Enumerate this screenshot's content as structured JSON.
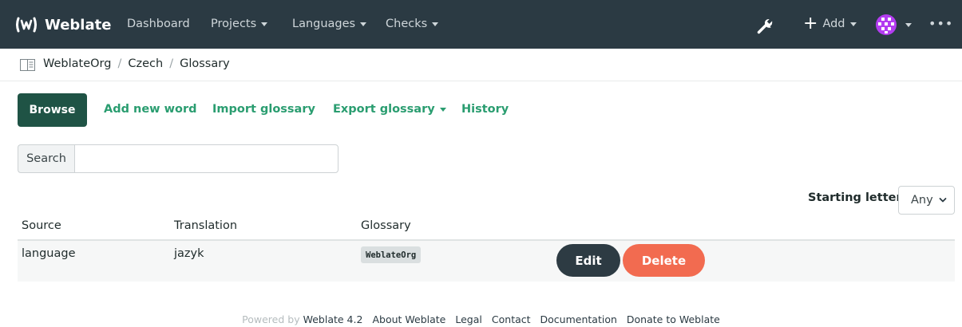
{
  "navbar": {
    "brand": "Weblate",
    "items": [
      {
        "label": "Dashboard"
      },
      {
        "label": "Projects"
      },
      {
        "label": "Languages"
      },
      {
        "label": "Checks"
      }
    ],
    "add_label": "Add",
    "more_label": "•••"
  },
  "breadcrumb": {
    "items": [
      "WeblateOrg",
      "Czech",
      "Glossary"
    ],
    "separator": "/"
  },
  "tabs": {
    "browse": "Browse",
    "add_new_word": "Add new word",
    "import_glossary": "Import glossary",
    "export_glossary": "Export glossary",
    "history": "History"
  },
  "search": {
    "button_label": "Search",
    "value": ""
  },
  "filter": {
    "label": "Starting letter",
    "selected": "Any"
  },
  "table": {
    "headers": [
      "Source",
      "Translation",
      "Glossary"
    ],
    "rows": [
      {
        "source": "language",
        "translation": "jazyk",
        "glossary": "WeblateOrg",
        "edit": "Edit",
        "delete": "Delete"
      }
    ]
  },
  "footer": {
    "powered_by": "Powered by",
    "links": [
      "Weblate 4.2",
      "About Weblate",
      "Legal",
      "Contact",
      "Documentation",
      "Donate to Weblate"
    ]
  },
  "colors": {
    "navbar": "#2b3a43",
    "accent": "#2a9d70",
    "browse_active": "#1f5345",
    "delete": "#f26b50",
    "edit": "#2d3b43",
    "avatar": "#b33cf0"
  },
  "icons": {
    "brand": "weblate-logo-icon",
    "admin": "wrench-icon",
    "add": "plus-icon",
    "user": "avatar-icon",
    "breadcrumb": "book-icon"
  }
}
